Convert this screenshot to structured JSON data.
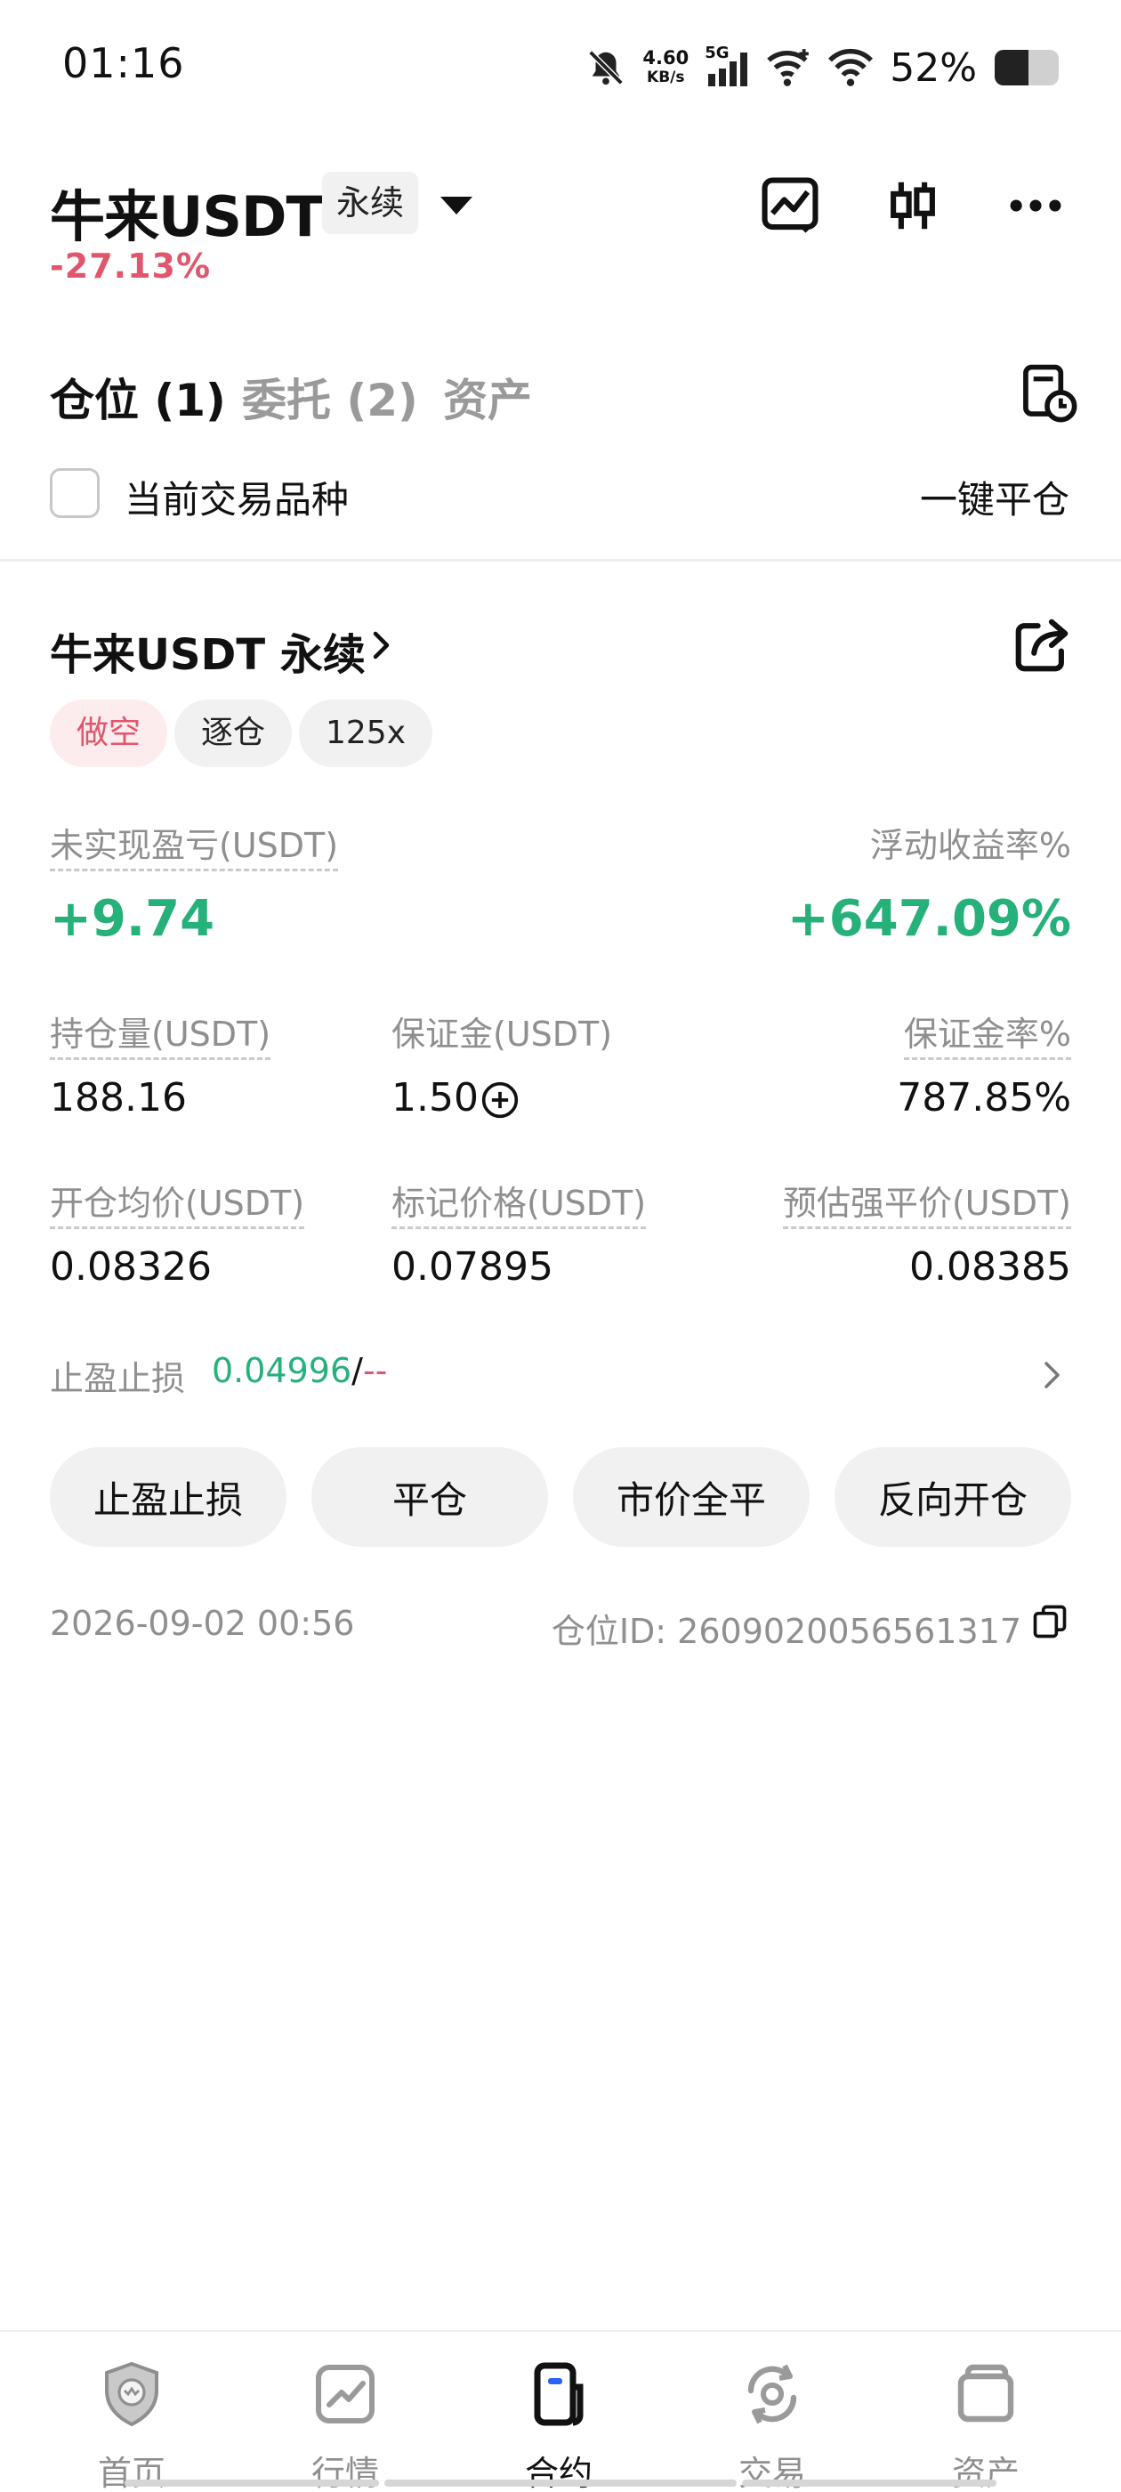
{
  "status_bar": {
    "time": "01:16",
    "net_speed_value": "4.60",
    "net_speed_unit": "KB/s",
    "signal_label": "5G",
    "battery": "52%"
  },
  "header": {
    "pair": "牛来USDT",
    "contract_type": "永续",
    "change": "-27.13%",
    "icons": [
      "chart-icon",
      "candlestick-icon",
      "more-icon"
    ]
  },
  "tabs": [
    {
      "label": "仓位 (1)",
      "active": true
    },
    {
      "label": "委托 (2)",
      "active": false
    },
    {
      "label": "资产",
      "active": false
    }
  ],
  "filter": {
    "current_pair_label": "当前交易品种",
    "close_all_label": "一键平仓"
  },
  "position": {
    "title": "牛来USDT 永续",
    "tags": [
      "做空",
      "逐仓",
      "125x"
    ],
    "unrealized_pnl_label": "未实现盈亏(USDT)",
    "unrealized_pnl": "+9.74",
    "roe_label": "浮动收益率%",
    "roe": "+647.09%",
    "size_label": "持仓量(USDT)",
    "size": "188.16",
    "margin_label": "保证金(USDT)",
    "margin": "1.50",
    "margin_ratio_label": "保证金率%",
    "margin_ratio": "787.85%",
    "entry_price_label": "开仓均价(USDT)",
    "entry_price": "0.08326",
    "mark_price_label": "标记价格(USDT)",
    "mark_price": "0.07895",
    "liq_price_label": "预估强平价(USDT)",
    "liq_price": "0.08385",
    "sltp_label": "止盈止损",
    "tp_value": "0.04996",
    "sltp_sep": "/",
    "sl_value": "--",
    "buttons": [
      "止盈止损",
      "平仓",
      "市价全平",
      "反向开仓"
    ],
    "open_time": "2026-09-02 00:56",
    "position_id": "仓位ID: 2609020056561317"
  },
  "bottom_nav": [
    {
      "label": "首页",
      "icon": "home-shield-icon",
      "active": false
    },
    {
      "label": "行情",
      "icon": "market-chart-icon",
      "active": false
    },
    {
      "label": "合约",
      "icon": "contract-icon",
      "active": true
    },
    {
      "label": "交易",
      "icon": "trade-exchange-icon",
      "active": false
    },
    {
      "label": "资产",
      "icon": "wallet-icon",
      "active": false
    }
  ],
  "colors": {
    "green": "#26b07a",
    "red": "#e0566c",
    "grey_text": "#8f8f8f",
    "chip_bg": "#f1f1f1"
  }
}
